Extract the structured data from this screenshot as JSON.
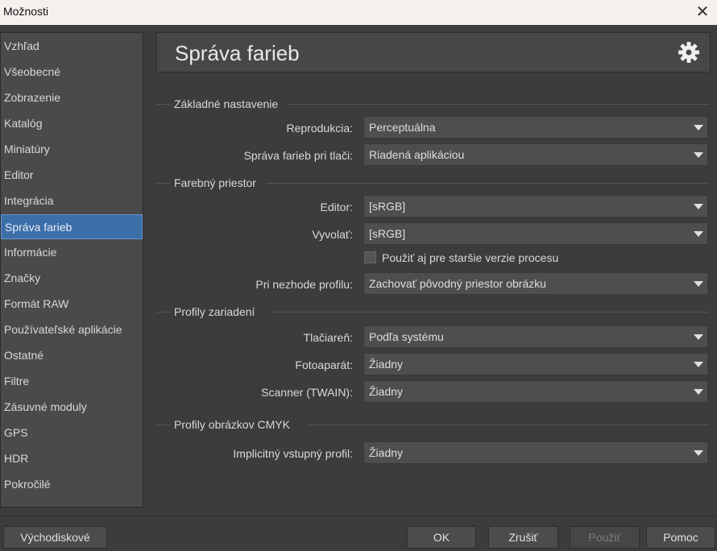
{
  "window": {
    "title": "Možnosti"
  },
  "sidebar": {
    "items": [
      {
        "label": "Vzhľad"
      },
      {
        "label": "Všeobecné"
      },
      {
        "label": "Zobrazenie"
      },
      {
        "label": "Katalóg"
      },
      {
        "label": "Miniatúry"
      },
      {
        "label": "Editor"
      },
      {
        "label": "Integrácia"
      },
      {
        "label": "Správa farieb",
        "selected": true
      },
      {
        "label": "Informácie"
      },
      {
        "label": "Značky"
      },
      {
        "label": "Formát RAW"
      },
      {
        "label": "Používateľské aplikácie"
      },
      {
        "label": "Ostatné"
      },
      {
        "label": "Filtre"
      },
      {
        "label": "Zásuvné moduly"
      },
      {
        "label": "GPS"
      },
      {
        "label": "HDR"
      },
      {
        "label": "Pokročilé"
      }
    ]
  },
  "header": {
    "title": "Správa farieb",
    "icon": "gear-icon"
  },
  "sections": {
    "basic": {
      "title": "Základné nastavenie",
      "reproduction": {
        "label": "Reprodukcia:",
        "value": "Perceptuálna"
      },
      "print": {
        "label": "Správa farieb pri tlači:",
        "value": "Riadená aplikáciou"
      }
    },
    "colorspace": {
      "title": "Farebný priestor",
      "editor": {
        "label": "Editor:",
        "value": "[sRGB]"
      },
      "develop": {
        "label": "Vyvolať:",
        "value": "[sRGB]"
      },
      "legacy_checkbox": {
        "label": "Použiť aj pre staršie verzie procesu",
        "checked": false
      },
      "mismatch": {
        "label": "Pri nezhode profilu:",
        "value": "Zachovať pôvodný priestor obrázku"
      }
    },
    "devices": {
      "title": "Profily zariadení",
      "printer": {
        "label": "Tlačiareň:",
        "value": "Podľa systému"
      },
      "camera": {
        "label": "Fotoaparát:",
        "value": "Žiadny"
      },
      "scanner": {
        "label": "Scanner (TWAIN):",
        "value": "Žiadny"
      }
    },
    "cmyk": {
      "title": "Profily obrázkov CMYK",
      "input_profile": {
        "label": "Implicitný vstupný profil:",
        "value": "Žiadny"
      }
    }
  },
  "buttons": {
    "defaults": "Východiskové",
    "ok": "OK",
    "cancel": "Zrušiť",
    "apply": "Použiť",
    "help": "Pomoc"
  },
  "colors": {
    "selected": "#3c6ea8",
    "background": "#3c3c3c",
    "titlebar": "#f4f0ee"
  }
}
